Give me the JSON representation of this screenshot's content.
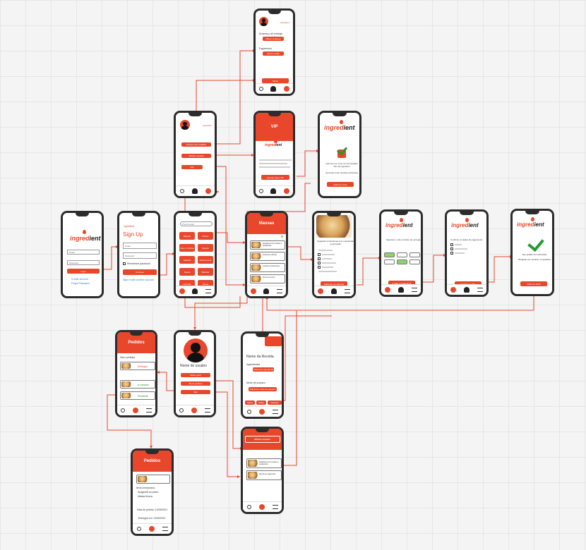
{
  "brand": {
    "logo_main": "ingred",
    "logo_accent": "ient",
    "accent_color": "#e8472b"
  },
  "login": {
    "email_placeholder": "Email",
    "password_placeholder": "Password",
    "login_button": "Login",
    "create_account": "Create account",
    "forgot_password": "Forgot Password"
  },
  "signup": {
    "brand_small": "ingredient",
    "title": "Sign Up",
    "email_placeholder": "Email",
    "password_placeholder": "Password",
    "remember": "Remember password",
    "continue_button": "Continue",
    "signin_link": "Sign in with another account"
  },
  "categories": {
    "search_placeholder": "Procure aqui",
    "items": [
      "Massas",
      "Peixes",
      "Aves e Carnes",
      "Vegano",
      "Saladas",
      "Sobremesas",
      "Sopas",
      "Bebidas",
      "Lanches",
      "Doces"
    ]
  },
  "menu": {
    "items": [
      "Acesse seus pedidos",
      "Minhas receitas",
      "Sair"
    ]
  },
  "settings": {
    "label_address": "Endereço de entrega",
    "btn_address": "Alterar endereço",
    "label_payment": "Pagamento",
    "btn_payment": "Alterar cartão",
    "btn_save": "Salvar"
  },
  "vip": {
    "title": "VIP",
    "btn": "Assinar plano VIP"
  },
  "thanks": {
    "msg": "Que bom ter você na comunidade VIP da Ingredient",
    "msg2": "Aproveite suas receitas exclusivas",
    "btn": "Voltar ao início"
  },
  "massas": {
    "title": "Massas",
    "items": [
      "Spaghetti com tomates e manjericão",
      "Fettuccine alfredo",
      "Lasanha à bolonhesa",
      "Penne ao pesto"
    ]
  },
  "recipe": {
    "title": "Spaghetti à bolonhesa com manjericão e parmesão",
    "btn": "Adicionar ao carrinho"
  },
  "delivery": {
    "text": "Selecione o dia e horário de entrega",
    "btn": "Ir para o pagamento"
  },
  "payment": {
    "text": "Confirme os dados de pagamento",
    "btn": "Finalizar pedido"
  },
  "confirm": {
    "text": "Seu pedido foi confirmado",
    "text2": "Obrigado por escolher a Ingredient",
    "btn": "Voltar ao início"
  },
  "pedidos": {
    "title": "Pedidos",
    "section": "Seus pedidos",
    "status": [
      "Entregue",
      "A caminho",
      "Pendente"
    ]
  },
  "profile": {
    "name": "Nome do usuário",
    "items": [
      "Editar perfil",
      "Meus pedidos",
      "Sair"
    ]
  },
  "newrecipe": {
    "title": "Nome da Receita",
    "label1": "Ingredientes",
    "btn1": "Adicionar ingrediente",
    "label2": "Modo de preparo",
    "btn2": "Adicionar modo de preparo",
    "tabs": [
      "Salvar",
      "Editar",
      "Publicar"
    ]
  },
  "myrecipes": {
    "title": "Minhas receitas",
    "items": [
      "Spaghetti com tomates e manjericão",
      "Risoto de cogumelos"
    ]
  },
  "detail": {
    "title": "Pedidos",
    "section": "Itens comprados:",
    "items": [
      "Spaghetti ao pesto",
      "Massa fresca"
    ],
    "date": "Data do pedido: 12/06/2021",
    "note": "Entregue em 13/06/2021"
  }
}
